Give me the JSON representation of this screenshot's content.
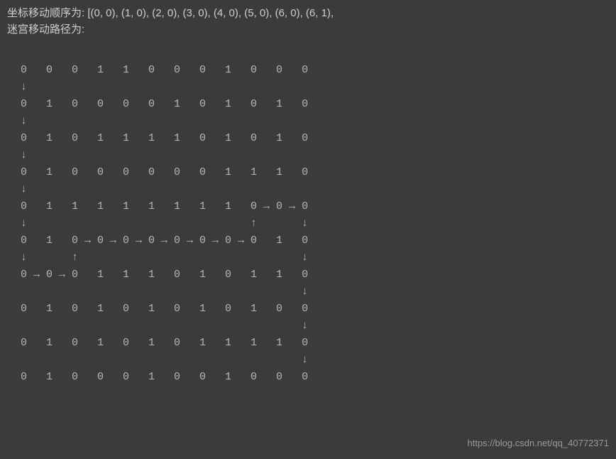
{
  "header": {
    "line1": "坐标移动顺序为: [(0, 0), (1, 0), (2, 0), (3, 0), (4, 0), (5, 0), (6, 0), (6, 1),",
    "line2": "迷宫移动路径为:"
  },
  "maze_rows": [
    " 0   0   0   1   1   0   0   0   1   0   0   0",
    " ↓",
    " 0   1   0   0   0   0   1   0   1   0   1   0",
    " ↓",
    " 0   1   0   1   1   1   1   0   1   0   1   0",
    " ↓",
    " 0   1   0   0   0   0   0   0   1   1   1   0",
    " ↓",
    " 0   1   1   1   1   1   1   1   1   0 → 0 → 0",
    " ↓                                   ↑       ↓",
    " 0   1   0 → 0 → 0 → 0 → 0 → 0 → 0 → 0   1   0",
    " ↓       ↑                                   ↓",
    " 0 → 0 → 0   1   1   1   0   1   0   1   1   0",
    "                                             ↓",
    " 0   1   0   1   0   1   0   1   0   1   0   0",
    "                                             ↓",
    " 0   1   0   1   0   1   0   1   1   1   1   0",
    "                                             ↓",
    " 0   1   0   0   0   1   0   0   1   0   0   0"
  ],
  "watermark": "https://blog.csdn.net/qq_40772371"
}
